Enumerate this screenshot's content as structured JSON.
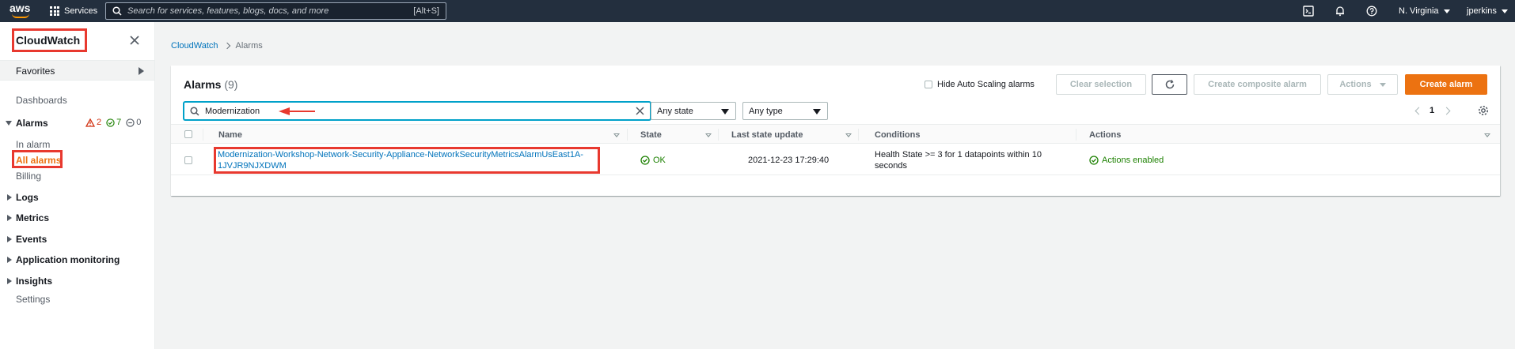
{
  "topnav": {
    "logo": "aws",
    "services_label": "Services",
    "search_placeholder": "Search for services, features, blogs, docs, and more",
    "search_shortcut": "[Alt+S]",
    "region": "N. Virginia",
    "user": "jperkins",
    "icons": [
      "cloudshell-icon",
      "bell-icon",
      "help-icon"
    ]
  },
  "sidenav": {
    "title": "CloudWatch",
    "favorites": "Favorites",
    "dashboards": "Dashboards",
    "alarms": "Alarms",
    "alarm_counts": {
      "alarm": "2",
      "ok": "7",
      "insufficient": "0"
    },
    "in_alarm": "In alarm",
    "all_alarms": "All alarms",
    "billing": "Billing",
    "logs": "Logs",
    "metrics": "Metrics",
    "events": "Events",
    "app_monitoring": "Application monitoring",
    "insights": "Insights",
    "settings": "Settings"
  },
  "breadcrumb": {
    "root": "CloudWatch",
    "current": "Alarms"
  },
  "panel": {
    "title": "Alarms",
    "count": "(9)",
    "hide_autoscaling": "Hide Auto Scaling alarms",
    "clear_selection": "Clear selection",
    "create_composite": "Create composite alarm",
    "actions": "Actions",
    "create_alarm": "Create alarm",
    "filter_value": "Modernization",
    "state_select": "Any state",
    "type_select": "Any type",
    "page": "1"
  },
  "table": {
    "columns": [
      "Name",
      "State",
      "Last state update",
      "Conditions",
      "Actions"
    ],
    "rows": [
      {
        "name_line1": "Modernization-Workshop-Network-Security-Appliance-NetworkSecurityMetricsAlarmUsEast1A-",
        "name_line2": "1JVJR9NJXDWM",
        "state": "OK",
        "last_update": "2021-12-23 17:29:40",
        "conditions_line1": "Health State >= 3 for 1 datapoints within 10",
        "conditions_line2": "seconds",
        "actions": "Actions enabled"
      }
    ]
  },
  "colors": {
    "accent": "#ec7211",
    "link": "#0073bb",
    "ok": "#1d8102",
    "alarm": "#d13212",
    "highlight": "#e8392f"
  }
}
